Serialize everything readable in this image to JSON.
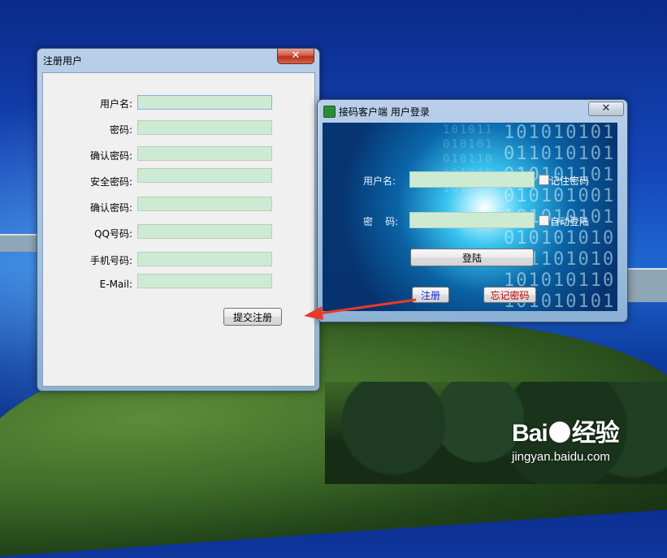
{
  "register_window": {
    "title": "注册用户",
    "close_symbol": "✕",
    "fields": [
      {
        "label": "用户名:",
        "value": ""
      },
      {
        "label": "密码:",
        "value": ""
      },
      {
        "label": "确认密码:",
        "value": ""
      },
      {
        "label": "安全密码:",
        "value": ""
      },
      {
        "label": "确认密码:",
        "value": ""
      },
      {
        "label": "QQ号码:",
        "value": ""
      },
      {
        "label": "手机号码:",
        "value": ""
      },
      {
        "label": "E-Mail:",
        "value": ""
      }
    ],
    "submit_label": "提交注册"
  },
  "login_window": {
    "title": "接码客户端 用户登录",
    "close_symbol": "✕",
    "username_label": "用户名:",
    "password_label": "密    码:",
    "remember_label": "记住密码",
    "autologin_label": "自动登陆",
    "login_label": "登陆",
    "register_label": "注册",
    "forgot_label": "忘记密码",
    "bg_digits": "101010101011010101010101101010101001101010101010101010101101010101010110101010101010",
    "bg_digits_small": "1010110101010101101010101010"
  },
  "watermark": {
    "logo_pre": "Bai",
    "logo_post": "经验",
    "url": "jingyan.baidu.com"
  },
  "colors": {
    "input_bg": "#cdebd3",
    "register_link": "#1a2bd6",
    "forgot_link": "#c00000",
    "arrow": "#e8392c"
  }
}
